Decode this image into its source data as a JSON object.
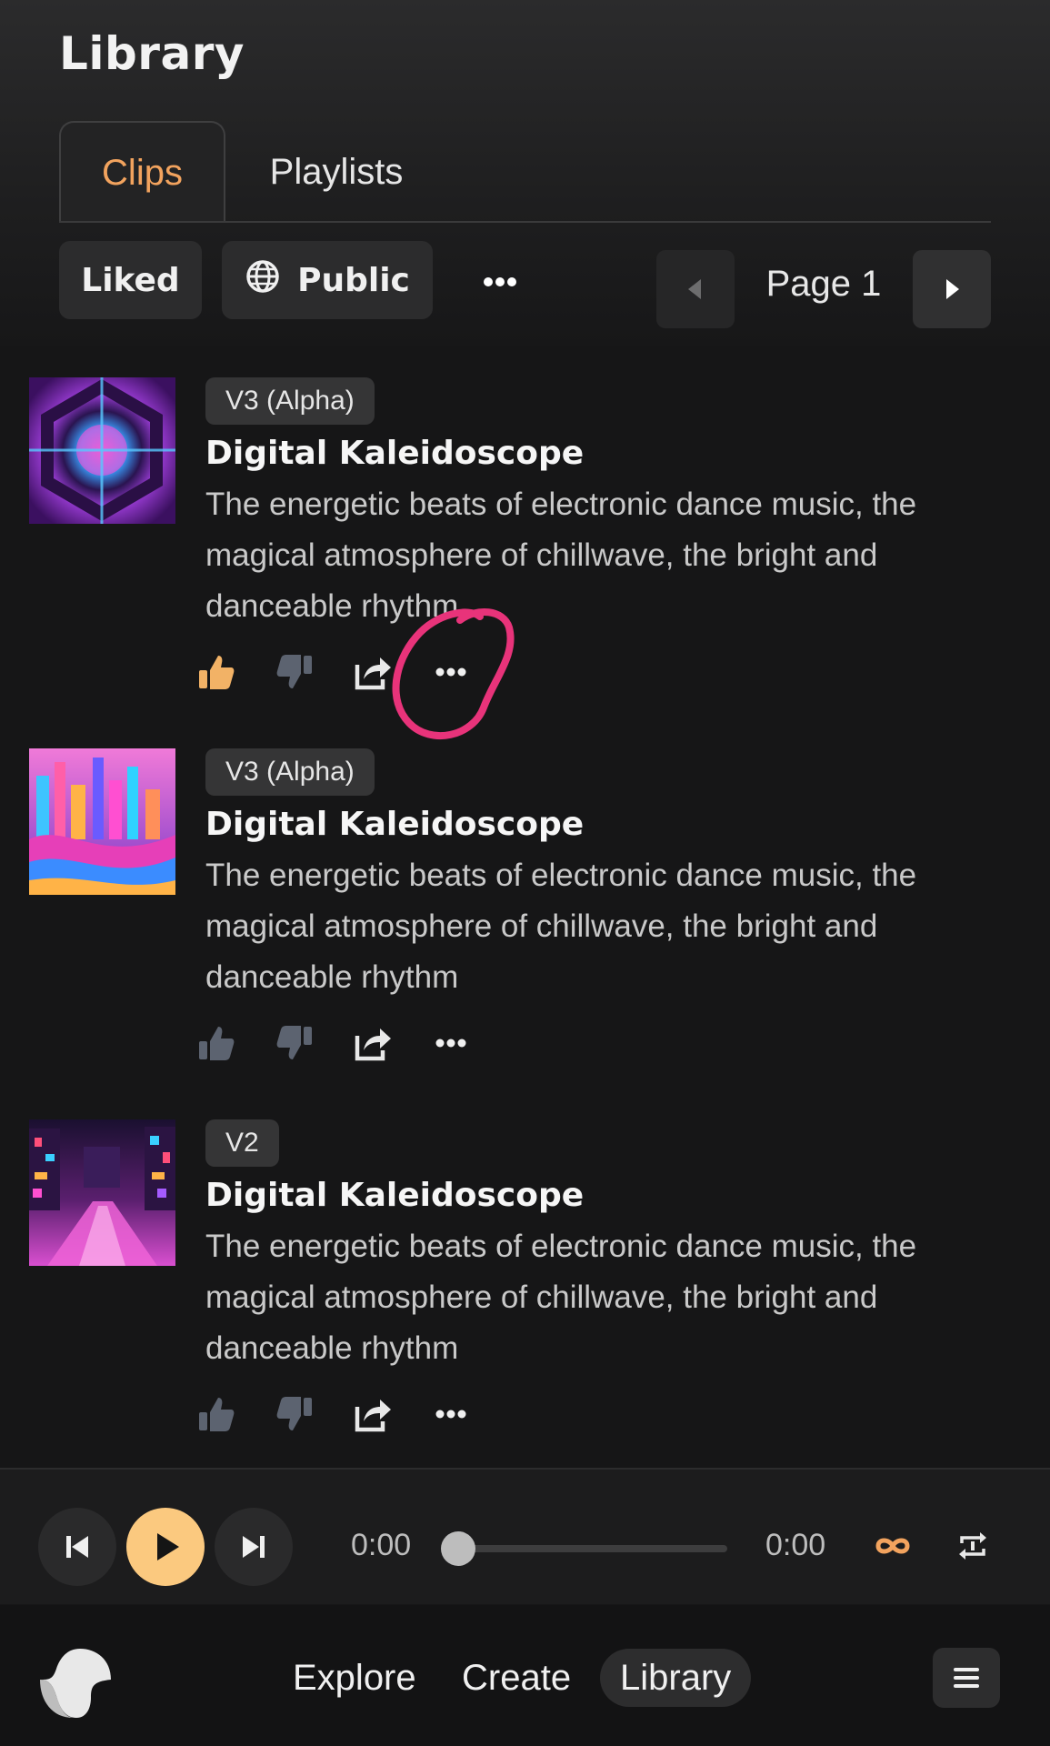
{
  "header": {
    "title": "Library"
  },
  "tabs": [
    {
      "label": "Clips",
      "active": true
    },
    {
      "label": "Playlists",
      "active": false
    }
  ],
  "filters": {
    "liked": "Liked",
    "public": "Public",
    "more_icon": "ellipsis-icon"
  },
  "pager": {
    "label": "Page 1"
  },
  "clips": [
    {
      "badge": "V3 (Alpha)",
      "title": "Digital Kaleidoscope",
      "description": "The energetic beats of electronic dance music, the magical atmosphere of chillwave, the bright and danceable rhythm",
      "liked": true
    },
    {
      "badge": "V3 (Alpha)",
      "title": "Digital Kaleidoscope",
      "description": "The energetic beats of electronic dance music, the magical atmosphere of chillwave, the bright and danceable rhythm",
      "liked": false
    },
    {
      "badge": "V2",
      "title": "Digital Kaleidoscope",
      "description": "The energetic beats of electronic dance music, the magical atmosphere of chillwave, the bright and danceable rhythm",
      "liked": false
    }
  ],
  "player": {
    "current_time": "0:00",
    "duration": "0:00",
    "progress": 0
  },
  "nav": {
    "explore": "Explore",
    "create": "Create",
    "library": "Library"
  },
  "colors": {
    "accent": "#f2a35e",
    "play": "#fbc97f",
    "annotation": "#e8337a"
  }
}
